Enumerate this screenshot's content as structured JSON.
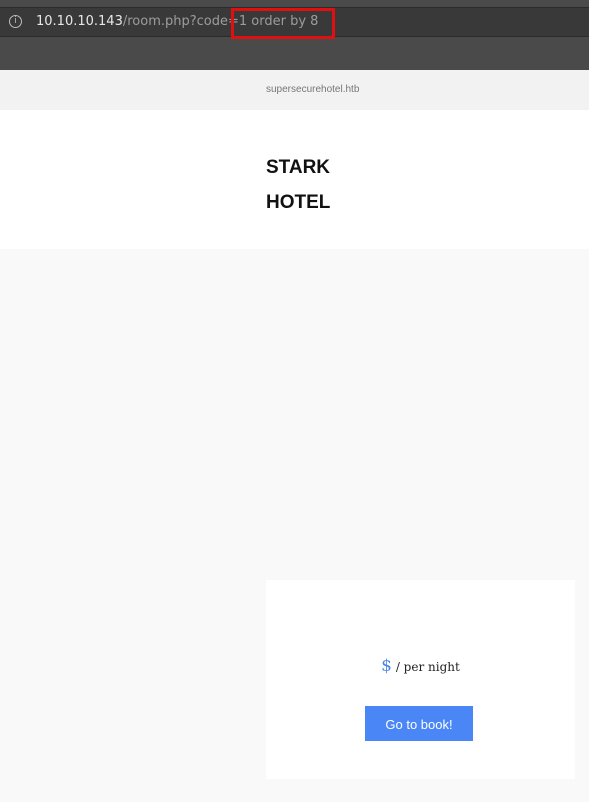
{
  "browser": {
    "url_host": "10.10.10.143",
    "url_path": "/room.php?code=1 order by 8",
    "info_icon": "info-icon"
  },
  "site": {
    "domain": "supersecurehotel.htb"
  },
  "header": {
    "name_line1": "STARK",
    "name_line2": "HOTEL"
  },
  "booking": {
    "currency": "$",
    "per_night": "/ per night",
    "button_label": "Go to book!"
  },
  "colors": {
    "accent": "#4a86f5",
    "highlight": "#e01010"
  }
}
